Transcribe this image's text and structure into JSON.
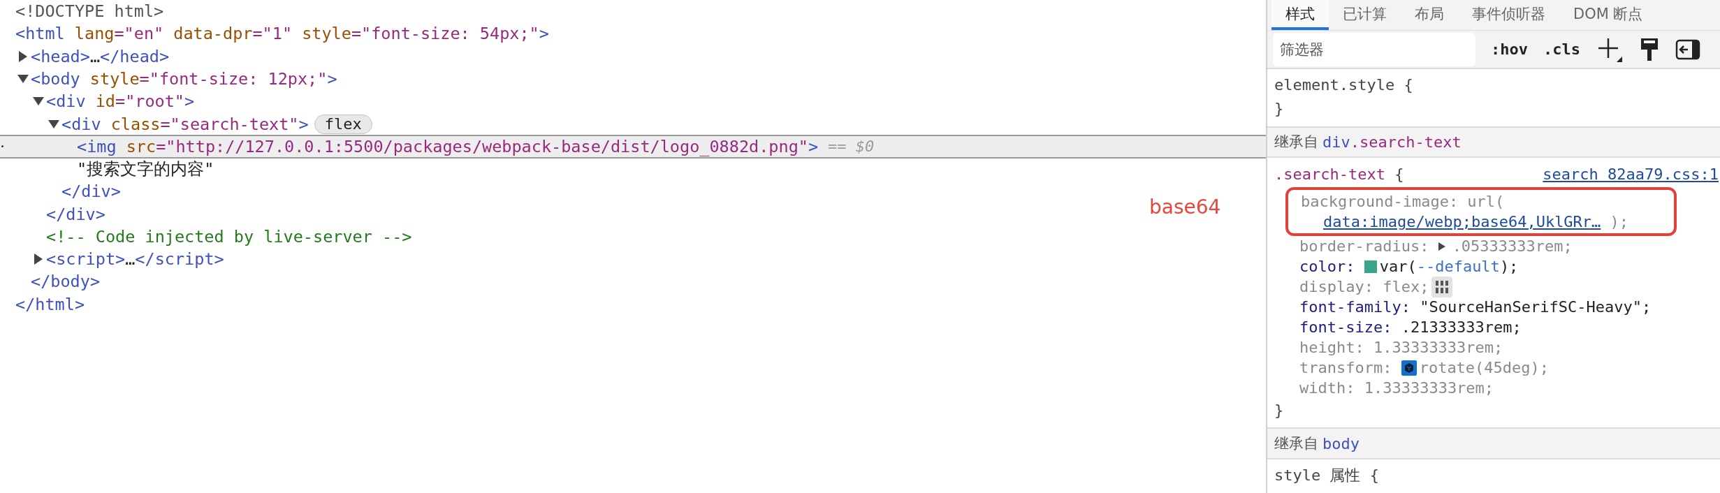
{
  "dom_tree": {
    "nodes": [
      {
        "kind": "doctype",
        "text": "<!DOCTYPE html>",
        "selected": false
      },
      {
        "kind": "root",
        "open": "<html",
        "attrs": [
          {
            "name": "lang",
            "value": "=\"en\""
          },
          {
            "name": "data-dpr",
            "value": "=\"1\""
          },
          {
            "name": "style",
            "value": "=\"font-size: 54px;\""
          }
        ],
        "end": ">",
        "close": "</html>",
        "selected": false,
        "children": [
          {
            "kind": "element",
            "open": "<head",
            "end": ">",
            "expanded": false,
            "collapsed": "…",
            "close": "</head>",
            "selected": false
          },
          {
            "kind": "element",
            "open": "<body",
            "attrs": [
              {
                "name": "style",
                "value": "=\"font-size: 12px;\""
              }
            ],
            "end": ">",
            "expanded": true,
            "close": "</body>",
            "selected": false,
            "children": [
              {
                "kind": "element",
                "open": "<div",
                "attrs": [
                  {
                    "name": "id",
                    "value": "=\"root\""
                  }
                ],
                "end": ">",
                "expanded": true,
                "close": "</div>",
                "selected": false,
                "children": [
                  {
                    "kind": "element",
                    "open": "<div",
                    "attrs": [
                      {
                        "name": "class",
                        "value": "=\"search-text\""
                      }
                    ],
                    "end": ">",
                    "badge": "flex",
                    "expanded": true,
                    "close": "</div>",
                    "selected": false,
                    "children": [
                      {
                        "kind": "leaf",
                        "open": "<img",
                        "attrs": [
                          {
                            "name": "src",
                            "value": "=\"http://127.0.0.1:5500/packages/webpack-base/dist/logo_0882d.png\""
                          }
                        ],
                        "end": ">",
                        "ref": "== $0",
                        "selected": true
                      },
                      {
                        "kind": "text",
                        "text": "\"搜索文字的内容\"",
                        "selected": false
                      }
                    ]
                  }
                ]
              },
              {
                "kind": "comment",
                "text": "<!-- Code injected by live-server -->",
                "selected": false
              },
              {
                "kind": "element",
                "open": "<script",
                "end": ">",
                "expanded": false,
                "collapsed": "…",
                "close": "</script>",
                "selected": false
              }
            ]
          }
        ]
      }
    ]
  },
  "annotation": "base64",
  "styles_panel": {
    "tabs": [
      {
        "label": "样式",
        "selected": true
      },
      {
        "label": "已计算",
        "selected": false
      },
      {
        "label": "布局",
        "selected": false
      },
      {
        "label": "事件侦听器",
        "selected": false
      },
      {
        "label": "DOM 断点",
        "selected": false
      }
    ],
    "filter": {
      "placeholder": "筛选器"
    },
    "toolbar": [
      {
        "kind": "text",
        "label": ":hov"
      },
      {
        "kind": "text",
        "label": ".cls"
      },
      {
        "kind": "plus"
      },
      {
        "kind": "brush"
      },
      {
        "kind": "sidebar"
      }
    ],
    "sections": [
      {
        "kind": "rule",
        "class_selector": false,
        "selector": "element.style",
        "brace": "{",
        "close": "}"
      },
      {
        "kind": "inherited",
        "label": "继承自",
        "tag": "div",
        "cls": ".search-text"
      },
      {
        "kind": "rule",
        "class_selector": true,
        "selector": ".search-text",
        "brace": "{",
        "source": "search 82aa79.css:1",
        "close": "}",
        "highlighted_properties": [
          {
            "kind": "url",
            "name": "background-image:",
            "value": "url(",
            "link": "data:image/webp;base64,UklGRr…",
            "tail": " );",
            "inactive": true
          }
        ],
        "properties": [
          {
            "kind": "toggle",
            "name": "border-radius:",
            "value": ".05333333rem;",
            "inactive": true
          },
          {
            "kind": "swatch",
            "name": "color:",
            "color": "#3aa58a",
            "value": "var(",
            "link": "--default",
            "tail": ");",
            "inactive": false
          },
          {
            "kind": "flex",
            "name": "display:",
            "value": "flex;",
            "inactive": true
          },
          {
            "kind": "plain",
            "name": "font-family:",
            "value": "\"SourceHanSerifSC-Heavy\";",
            "inactive": false
          },
          {
            "kind": "plain",
            "name": "font-size:",
            "value": ".21333333rem;",
            "inactive": false
          },
          {
            "kind": "plain",
            "name": "height:",
            "value": "1.33333333rem;",
            "inactive": true
          },
          {
            "kind": "transform",
            "name": "transform:",
            "value": "rotate(45deg);",
            "inactive": true
          },
          {
            "kind": "plain",
            "name": "width:",
            "value": "1.33333333rem;",
            "inactive": true
          }
        ]
      },
      {
        "kind": "inherited",
        "label": "继承自",
        "tag": "body"
      },
      {
        "kind": "rule",
        "class_selector": false,
        "selector": "style 属性",
        "brace": "{"
      }
    ]
  }
}
